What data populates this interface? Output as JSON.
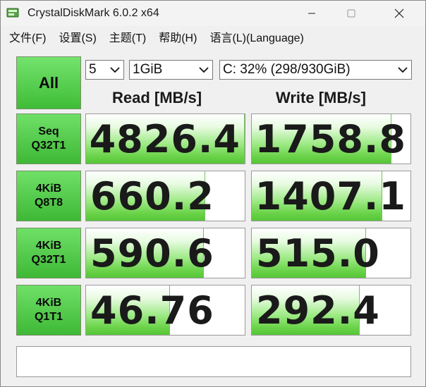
{
  "window": {
    "title": "CrystalDiskMark 6.0.2 x64"
  },
  "menu": [
    {
      "label": "文件(F)"
    },
    {
      "label": "设置(S)"
    },
    {
      "label": "主题(T)"
    },
    {
      "label": "帮助(H)"
    },
    {
      "label": "语言(L)(Language)"
    }
  ],
  "controls": {
    "all_label": "All",
    "count_value": "5",
    "size_value": "1GiB",
    "drive_value": "C: 32% (298/930GiB)"
  },
  "headers": {
    "read": "Read [MB/s]",
    "write": "Write [MB/s]"
  },
  "tests": [
    {
      "line1": "Seq",
      "line2": "Q32T1",
      "read": "4826.4",
      "write": "1758.8",
      "read_fill": 1.0,
      "write_fill": 0.88
    },
    {
      "line1": "4KiB",
      "line2": "Q8T8",
      "read": "660.2",
      "write": "1407.1",
      "read_fill": 0.75,
      "write_fill": 0.82
    },
    {
      "line1": "4KiB",
      "line2": "Q32T1",
      "read": "590.6",
      "write": "515.0",
      "read_fill": 0.74,
      "write_fill": 0.72
    },
    {
      "line1": "4KiB",
      "line2": "Q1T1",
      "read": "46.76",
      "write": "292.4",
      "read_fill": 0.53,
      "write_fill": 0.68
    }
  ],
  "comment": "",
  "icons": {
    "app": "crystaldiskmark-app-icon",
    "minimize": "minimize-icon",
    "maximize": "maximize-icon",
    "close": "close-icon",
    "dropdown": "chevron-down-icon"
  }
}
